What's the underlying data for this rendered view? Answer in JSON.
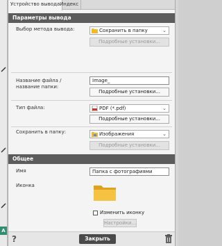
{
  "tabs": [
    {
      "label": "Устройство вывода",
      "active": true
    },
    {
      "label": "Индекс",
      "active": false
    }
  ],
  "output_section": {
    "title": "Параметры вывода",
    "method": {
      "label": "Выбор метода вывода:",
      "value": "Сохранить в папку",
      "settings_label": "Подробные установки..."
    },
    "filename": {
      "label": "Название файла / название папки:",
      "value": "Image_",
      "settings_label": "Подробные установки..."
    },
    "filetype": {
      "label": "Тип файла:",
      "value": "PDF (*.pdf)",
      "settings_label": "Подробные установки..."
    },
    "savefolder": {
      "label": "Сохранить в папку:",
      "value": "Изображения",
      "settings_label": "Подробные установки..."
    }
  },
  "general_section": {
    "title": "Общее",
    "name": {
      "label": "Имя",
      "value": "Папка с фотографиями"
    },
    "icon": {
      "label": "Иконка",
      "change_label": "Изменить иконку",
      "change_checked": false,
      "settings_label": "Настройки..."
    }
  },
  "footer": {
    "help": "?",
    "close_label": "Закрыть"
  },
  "strip": {
    "badge": "A"
  },
  "colors": {
    "header_bg": "#5c5c5c",
    "folder": "#f2b632",
    "close_bg": "#4a4a4a"
  }
}
